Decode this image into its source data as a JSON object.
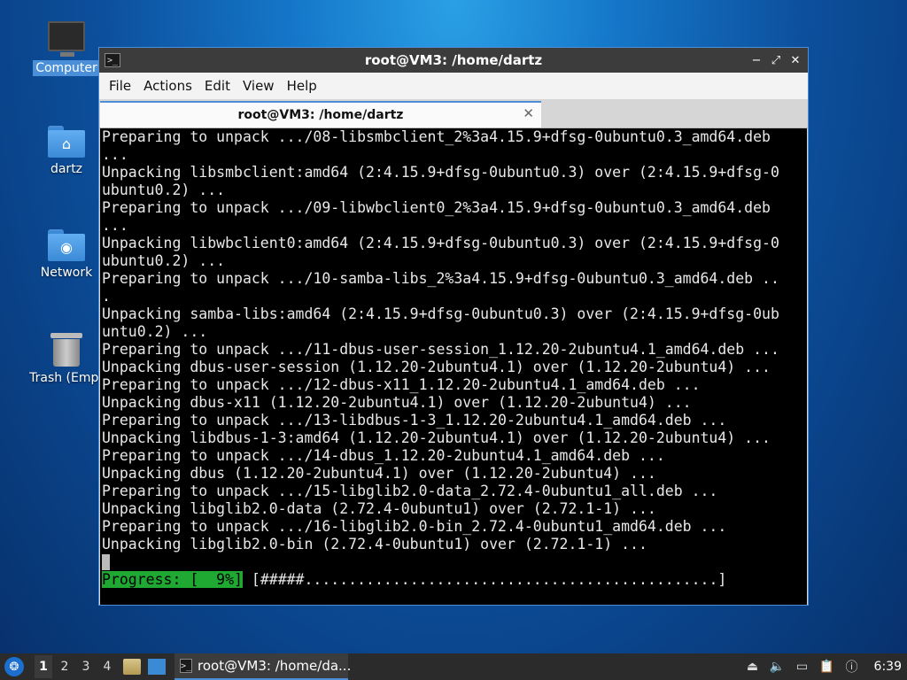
{
  "desktop": {
    "icons": [
      {
        "label": "Computer"
      },
      {
        "label": "dartz"
      },
      {
        "label": "Network"
      },
      {
        "label": "Trash (Empt"
      }
    ]
  },
  "window": {
    "title": "root@VM3: /home/dartz",
    "controls": {
      "minimize": "−",
      "maximize": "⤢",
      "close": "✕"
    },
    "menu": [
      "File",
      "Actions",
      "Edit",
      "View",
      "Help"
    ],
    "tab": {
      "label": "root@VM3: /home/dartz",
      "close": "✕"
    }
  },
  "terminal": {
    "lines": [
      "Preparing to unpack .../08-libsmbclient_2%3a4.15.9+dfsg-0ubuntu0.3_amd64.deb",
      "...",
      "Unpacking libsmbclient:amd64 (2:4.15.9+dfsg-0ubuntu0.3) over (2:4.15.9+dfsg-0",
      "ubuntu0.2) ...",
      "Preparing to unpack .../09-libwbclient0_2%3a4.15.9+dfsg-0ubuntu0.3_amd64.deb",
      "...",
      "Unpacking libwbclient0:amd64 (2:4.15.9+dfsg-0ubuntu0.3) over (2:4.15.9+dfsg-0",
      "ubuntu0.2) ...",
      "Preparing to unpack .../10-samba-libs_2%3a4.15.9+dfsg-0ubuntu0.3_amd64.deb ..",
      ".",
      "Unpacking samba-libs:amd64 (2:4.15.9+dfsg-0ubuntu0.3) over (2:4.15.9+dfsg-0ub",
      "untu0.2) ...",
      "Preparing to unpack .../11-dbus-user-session_1.12.20-2ubuntu4.1_amd64.deb ...",
      "Unpacking dbus-user-session (1.12.20-2ubuntu4.1) over (1.12.20-2ubuntu4) ...",
      "Preparing to unpack .../12-dbus-x11_1.12.20-2ubuntu4.1_amd64.deb ...",
      "Unpacking dbus-x11 (1.12.20-2ubuntu4.1) over (1.12.20-2ubuntu4) ...",
      "Preparing to unpack .../13-libdbus-1-3_1.12.20-2ubuntu4.1_amd64.deb ...",
      "Unpacking libdbus-1-3:amd64 (1.12.20-2ubuntu4.1) over (1.12.20-2ubuntu4) ...",
      "Preparing to unpack .../14-dbus_1.12.20-2ubuntu4.1_amd64.deb ...",
      "Unpacking dbus (1.12.20-2ubuntu4.1) over (1.12.20-2ubuntu4) ...",
      "Preparing to unpack .../15-libglib2.0-data_2.72.4-0ubuntu1_all.deb ...",
      "Unpacking libglib2.0-data (2.72.4-0ubuntu1) over (2.72.1-1) ...",
      "Preparing to unpack .../16-libglib2.0-bin_2.72.4-0ubuntu1_amd64.deb ...",
      "Unpacking libglib2.0-bin (2.72.4-0ubuntu1) over (2.72.1-1) ..."
    ],
    "progress_label": "Progress: [  9%]",
    "progress_bar": " [#####...............................................]",
    "progress_percent": 9
  },
  "taskbar": {
    "workspaces": [
      "1",
      "2",
      "3",
      "4"
    ],
    "active_workspace": "1",
    "task_label": "root@VM3: /home/da...",
    "clock": "6:39"
  }
}
